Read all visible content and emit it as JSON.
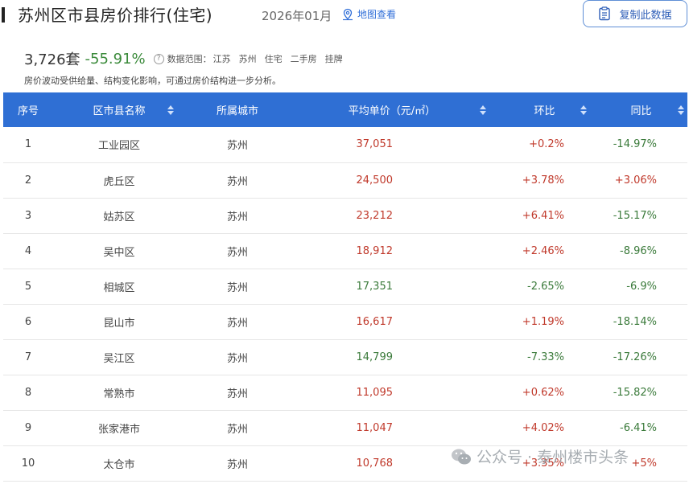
{
  "header": {
    "title": "苏州区市县房价排行(住宅)",
    "date": "2026年01月",
    "map_link": "地图查看",
    "copy_button": "复制此数据"
  },
  "stats": {
    "count": "3,726套",
    "change": "-55.91%",
    "help": "?",
    "scope_label": "数据范围：",
    "scope_tags": [
      "江苏",
      "苏州",
      "住宅",
      "二手房",
      "挂牌"
    ]
  },
  "note": "房价波动受供给量、结构变化影响，可通过房价结构进一步分析。",
  "table": {
    "headers": [
      "序号",
      "区市县名称",
      "所属城市",
      "平均单价（元/㎡）",
      "环比",
      "同比"
    ],
    "rows": [
      {
        "rank": "1",
        "district": "工业园区",
        "city": "苏州",
        "price": "37,051",
        "mom": "+0.2%",
        "yoy": "-14.97%"
      },
      {
        "rank": "2",
        "district": "虎丘区",
        "city": "苏州",
        "price": "24,500",
        "mom": "+3.78%",
        "yoy": "+3.06%"
      },
      {
        "rank": "3",
        "district": "姑苏区",
        "city": "苏州",
        "price": "23,212",
        "mom": "+6.41%",
        "yoy": "-15.17%"
      },
      {
        "rank": "4",
        "district": "吴中区",
        "city": "苏州",
        "price": "18,912",
        "mom": "+2.46%",
        "yoy": "-8.96%"
      },
      {
        "rank": "5",
        "district": "相城区",
        "city": "苏州",
        "price": "17,351",
        "mom": "-2.65%",
        "yoy": "-6.9%"
      },
      {
        "rank": "6",
        "district": "昆山市",
        "city": "苏州",
        "price": "16,617",
        "mom": "+1.19%",
        "yoy": "-18.14%"
      },
      {
        "rank": "7",
        "district": "吴江区",
        "city": "苏州",
        "price": "14,799",
        "mom": "-7.33%",
        "yoy": "-17.26%"
      },
      {
        "rank": "8",
        "district": "常熟市",
        "city": "苏州",
        "price": "11,095",
        "mom": "+0.62%",
        "yoy": "-15.82%"
      },
      {
        "rank": "9",
        "district": "张家港市",
        "city": "苏州",
        "price": "11,047",
        "mom": "+4.02%",
        "yoy": "-6.41%"
      },
      {
        "rank": "10",
        "district": "太仓市",
        "city": "苏州",
        "price": "10,768",
        "mom": "+3.35%",
        "yoy": "+5%"
      }
    ]
  },
  "watermark": "公众号 · 泰州楼市头条",
  "colors": {
    "header_bg": "#2f6fd4",
    "up": "#c0392b",
    "down": "#3a7a3a",
    "link": "#2f6ed8"
  }
}
